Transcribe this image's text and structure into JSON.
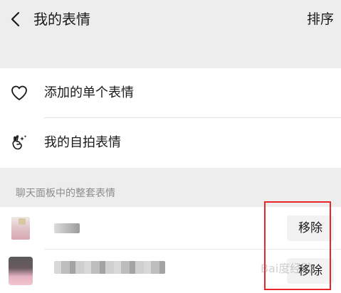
{
  "header": {
    "title": "我的表情",
    "sort_label": "排序"
  },
  "menu": {
    "items": [
      {
        "label": "添加的单个表情",
        "icon": "heart-icon"
      },
      {
        "label": "我的自拍表情",
        "icon": "selfie-hand-icon"
      }
    ]
  },
  "section": {
    "label": "聊天面板中的整套表情"
  },
  "packs": {
    "items": [
      {
        "remove_label": "移除"
      },
      {
        "remove_label": "移除"
      }
    ]
  },
  "watermark": {
    "text": "Bai度经验"
  },
  "colors": {
    "background": "#ededed",
    "card": "#ffffff",
    "text": "#191919",
    "secondary_text": "#8c8c8c",
    "annotation": "#e8262a"
  }
}
